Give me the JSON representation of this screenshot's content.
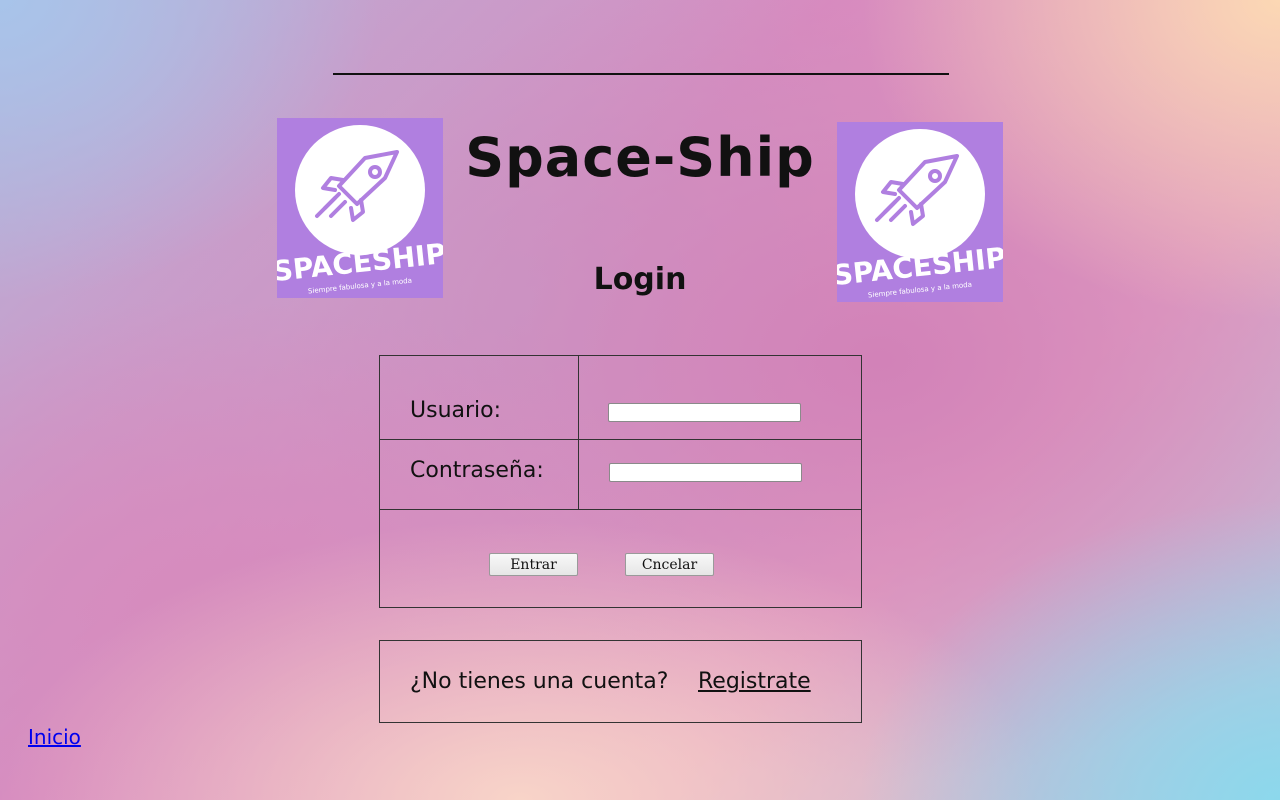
{
  "header": {
    "title": "Space-Ship",
    "subtitle": "Login"
  },
  "logo": {
    "brand": "SPACESHIP",
    "tagline": "Siempre fabulosa y a la moda",
    "icon": "rocket-icon",
    "background_color": "#b07fe0"
  },
  "form": {
    "username_label": "Usuario:",
    "username_value": "",
    "password_label": "Contraseña:",
    "password_value": "",
    "submit_label": "Entrar",
    "cancel_label": "Cncelar"
  },
  "register": {
    "prompt": "¿No tienes una cuenta?",
    "link_label": "Registrate"
  },
  "footer": {
    "home_link": "Inicio"
  }
}
